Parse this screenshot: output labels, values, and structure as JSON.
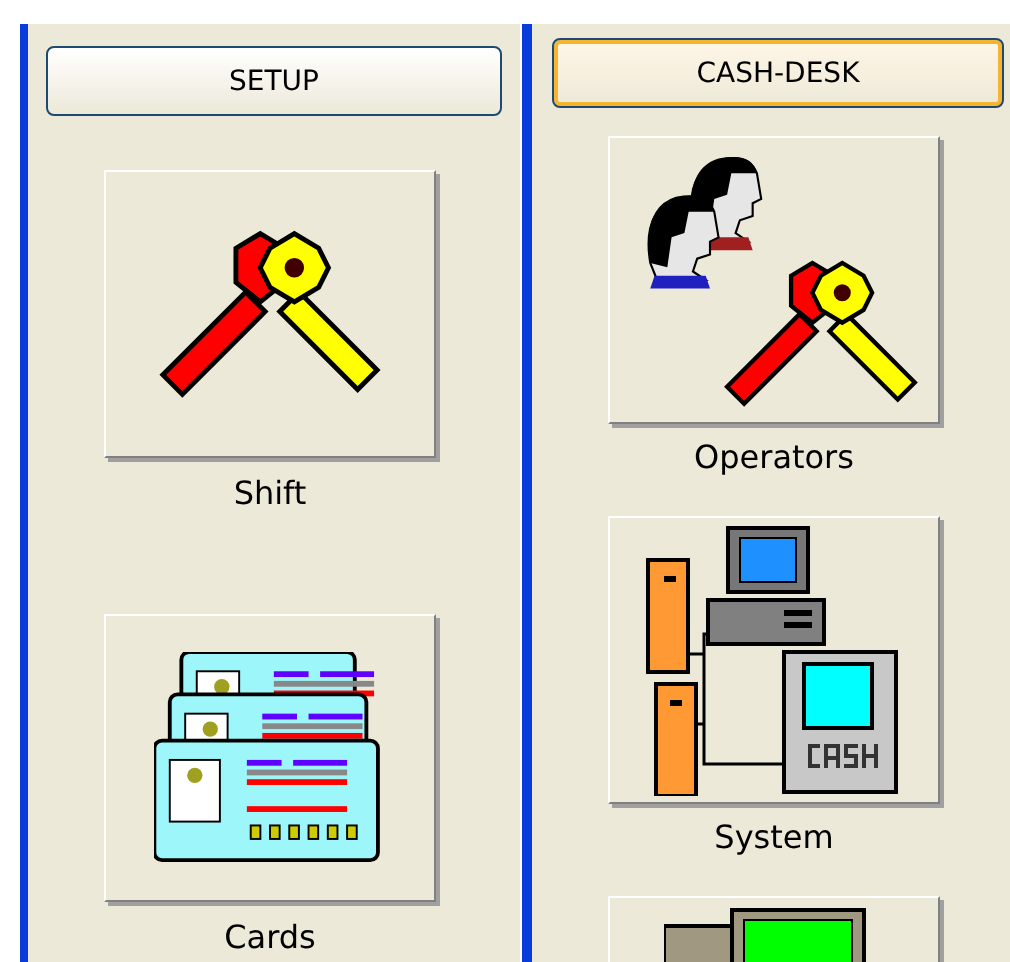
{
  "panels": [
    {
      "header": {
        "label": "SETUP",
        "focused": false
      },
      "tiles": [
        {
          "kind": "keys",
          "label": "Shift"
        },
        {
          "kind": "cards",
          "label": "Cards"
        }
      ]
    },
    {
      "header": {
        "label": "CASH-DESK",
        "focused": true
      },
      "tiles": [
        {
          "kind": "operators",
          "label": "Operators"
        },
        {
          "kind": "system",
          "label": "System"
        },
        {
          "kind": "monitor"
        }
      ]
    }
  ]
}
